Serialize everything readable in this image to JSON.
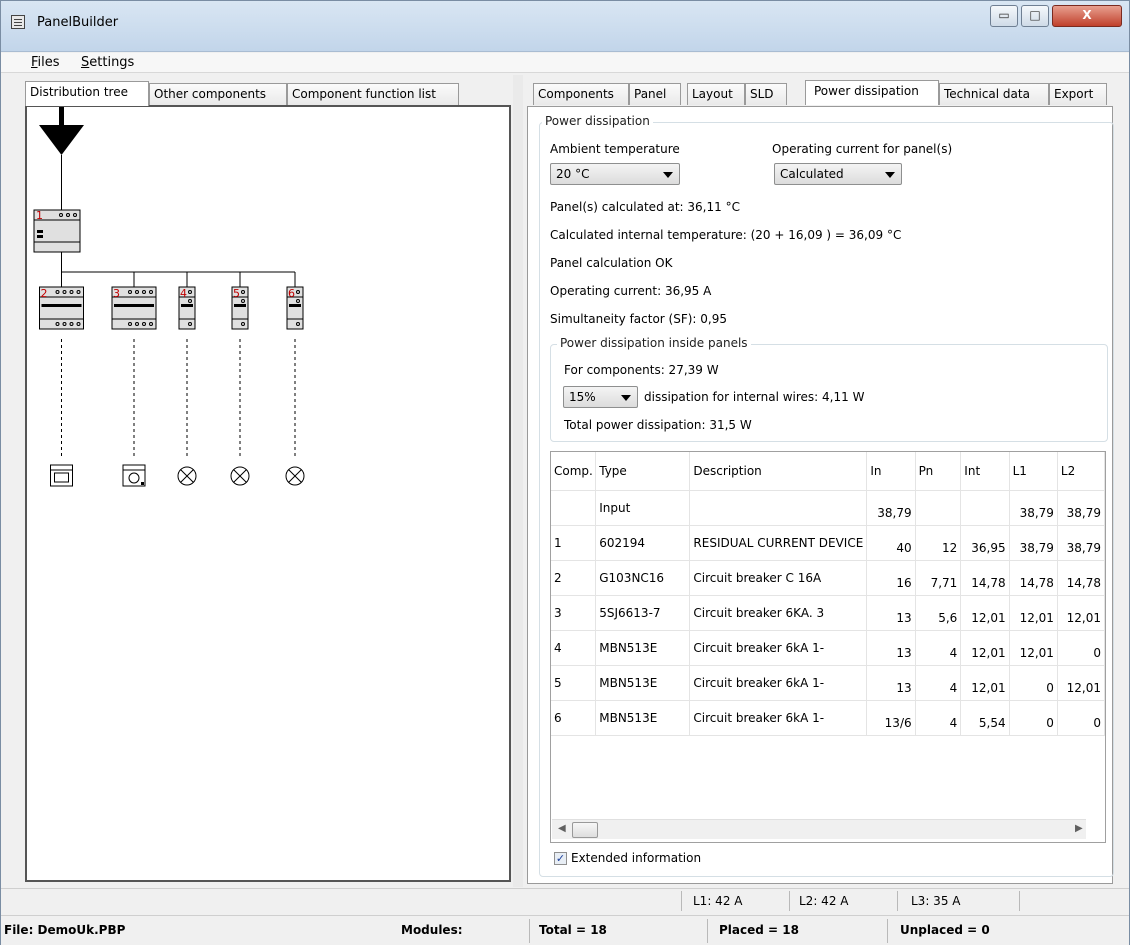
{
  "window": {
    "title": "PanelBuilder",
    "minimize": "▭",
    "maximize": "□",
    "close": "X"
  },
  "menu": {
    "files_u": "F",
    "files_rest": "iles",
    "settings_u": "S",
    "settings_rest": "ettings"
  },
  "left_tabs": [
    "Distribution tree",
    "Other components",
    "Component function list"
  ],
  "right_tabs": [
    "Components",
    "Panel",
    "Layout",
    "SLD",
    "Power dissipation",
    "Technical data",
    "Export"
  ],
  "tree": {
    "main_device_label": "1",
    "branch_labels": [
      "2",
      "3",
      "4",
      "5",
      "6"
    ],
    "loads": [
      "oven-icon",
      "washer-icon",
      "lamp-icon",
      "lamp-icon",
      "lamp-icon"
    ]
  },
  "power": {
    "group_title": "Power dissipation",
    "ambient_label": "Ambient temperature",
    "ambient_value": "20 °C",
    "current_label": "Operating current for panel(s)",
    "current_value": "Calculated",
    "calc_at": "Panel(s) calculated at: 36,11 °C",
    "internal_temp": "Calculated internal temperature: (20 + 16,09 ) = 36,09 °C",
    "calc_ok": "Panel calculation OK",
    "operating_current": "Operating current: 36,95 A",
    "sf": "Simultaneity factor (SF): 0,95",
    "inside": {
      "title": "Power dissipation inside panels",
      "components": "For components: 27,39 W",
      "wire_pct": "15%",
      "wires": "dissipation for internal wires: 4,11 W",
      "total": "Total power dissipation: 31,5 W"
    },
    "extended_label": "Extended information",
    "extended_checked": "✓"
  },
  "table": {
    "headers": [
      "Comp.",
      "Type",
      "Description",
      "In",
      "Pn",
      "Int",
      "L1",
      "L2"
    ],
    "rows": [
      [
        "",
        "Input",
        "",
        "38,79",
        "",
        "",
        "38,79",
        "38,79"
      ],
      [
        "1",
        "602194",
        "RESIDUAL CURRENT DEVICE",
        "40",
        "12",
        "36,95",
        "38,79",
        "38,79"
      ],
      [
        "2",
        "G103NC16",
        "Circuit breaker C 16A",
        "16",
        "7,71",
        "14,78",
        "14,78",
        "14,78"
      ],
      [
        "3",
        "5SJ6613-7",
        "Circuit breaker 6KA. 3",
        "13",
        "5,6",
        "12,01",
        "12,01",
        "12,01"
      ],
      [
        "4",
        "MBN513E",
        "Circuit breaker 6kA 1-",
        "13",
        "4",
        "12,01",
        "12,01",
        "0"
      ],
      [
        "5",
        "MBN513E",
        "Circuit breaker 6kA 1-",
        "13",
        "4",
        "12,01",
        "0",
        "12,01"
      ],
      [
        "6",
        "MBN513E",
        "Circuit breaker 6kA 1-",
        "13/6",
        "4",
        "5,54",
        "0",
        "0"
      ]
    ]
  },
  "status": {
    "l1": "L1: 42 A",
    "l2": "L2: 42 A",
    "l3": "L3: 35 A",
    "file": "File: DemoUk.PBP",
    "modules": "Modules:",
    "total": "Total = 18",
    "placed": "Placed = 18",
    "unplaced": "Unplaced = 0"
  }
}
